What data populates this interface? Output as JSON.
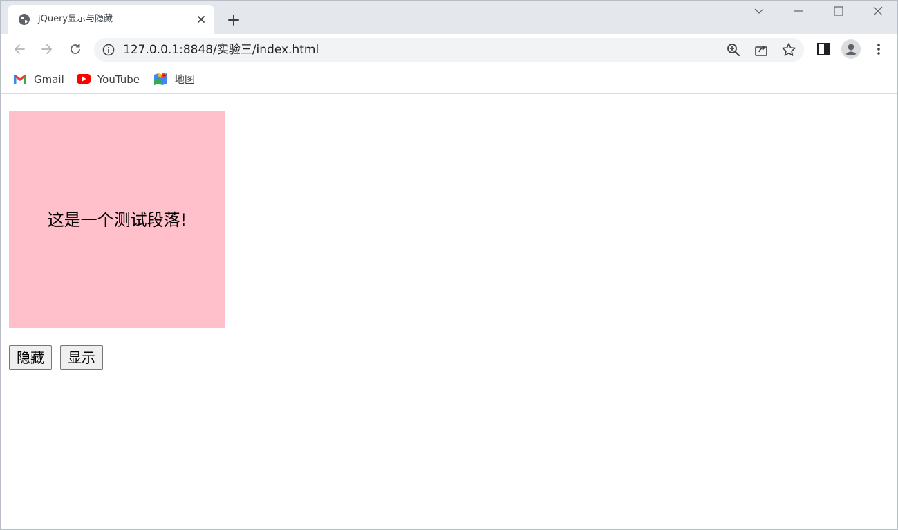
{
  "browser": {
    "tab_title": "jQuery显示与隐藏",
    "url": "127.0.0.1:8848/实验三/index.html"
  },
  "bookmarks": [
    {
      "label": "Gmail",
      "icon": "gmail-icon"
    },
    {
      "label": "YouTube",
      "icon": "youtube-icon"
    },
    {
      "label": "地图",
      "icon": "maps-icon"
    }
  ],
  "page": {
    "paragraph_text": "这是一个测试段落!",
    "box_color": "#ffc0cb",
    "hide_button_label": "隐藏",
    "show_button_label": "显示"
  }
}
